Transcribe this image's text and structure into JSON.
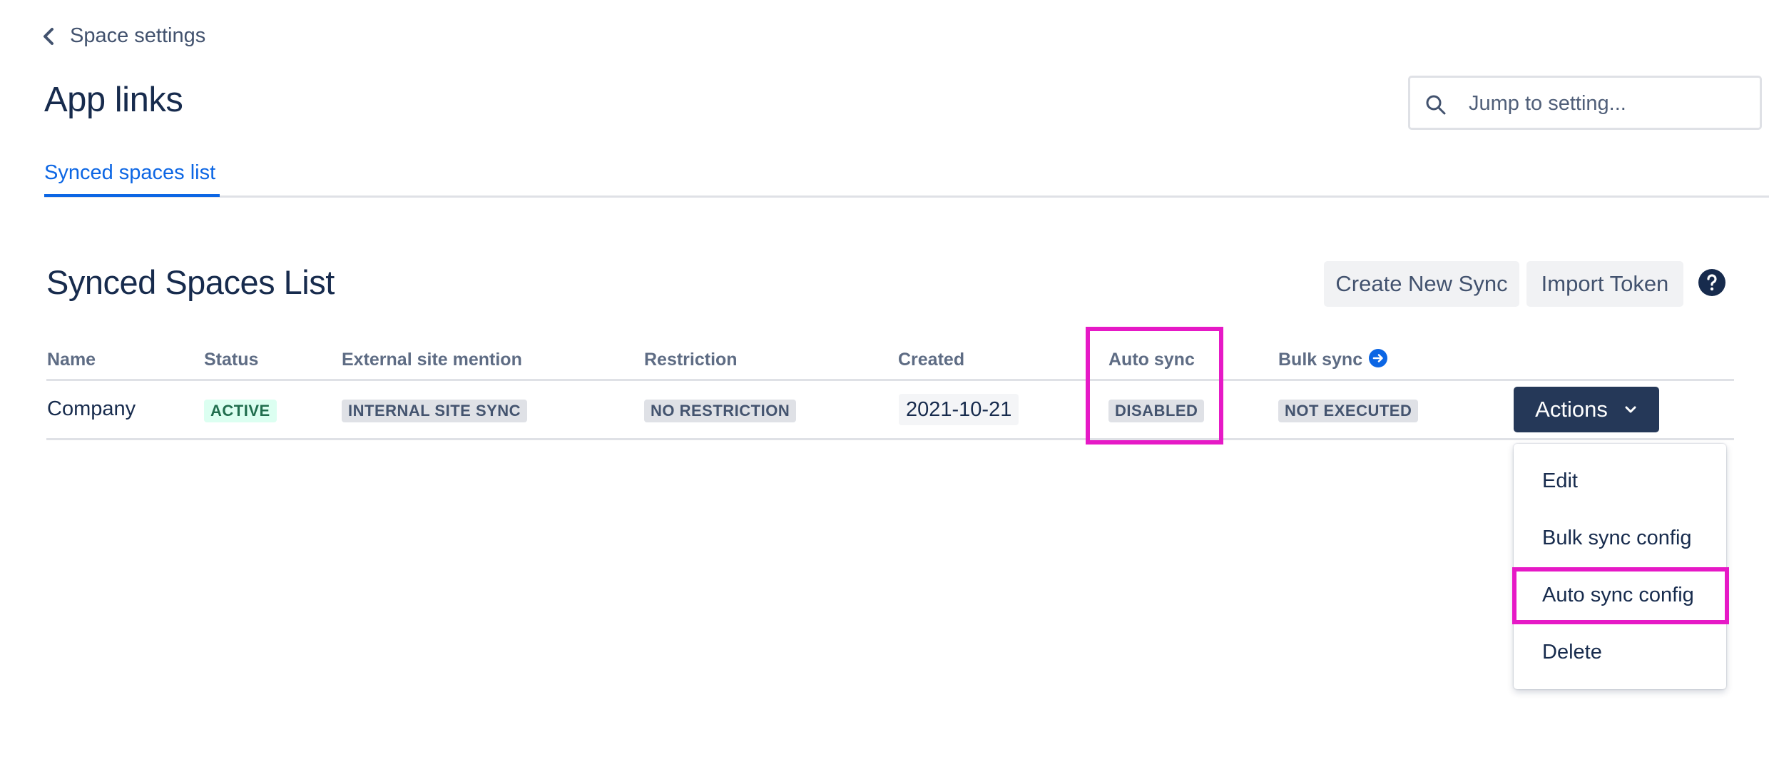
{
  "breadcrumb": {
    "label": "Space settings"
  },
  "page": {
    "title": "App links"
  },
  "search": {
    "placeholder": "Jump to setting...",
    "value": ""
  },
  "tabs": [
    {
      "label": "Synced spaces list",
      "active": true
    }
  ],
  "section": {
    "title": "Synced Spaces List",
    "create_button": "Create New Sync",
    "import_button": "Import Token"
  },
  "table": {
    "columns": [
      "Name",
      "Status",
      "External site mention",
      "Restriction",
      "Created",
      "Auto sync",
      "Bulk sync"
    ],
    "rows": [
      {
        "name": "Company",
        "status": "ACTIVE",
        "external_site_mention": "INTERNAL SITE SYNC",
        "restriction": "NO RESTRICTION",
        "created": "2021-10-21",
        "auto_sync": "DISABLED",
        "bulk_sync": "NOT EXECUTED",
        "actions_label": "Actions"
      }
    ]
  },
  "actions_menu": {
    "items": [
      "Edit",
      "Bulk sync config",
      "Auto sync config",
      "Delete"
    ]
  },
  "colors": {
    "accent": "#0c66e4",
    "primary_button": "#253858",
    "highlight": "#e619c6",
    "status_active": "#216e4e"
  },
  "icons": [
    "chevron-left-icon",
    "search-icon",
    "help-icon",
    "arrow-right-circle-icon",
    "chevron-down-icon"
  ]
}
